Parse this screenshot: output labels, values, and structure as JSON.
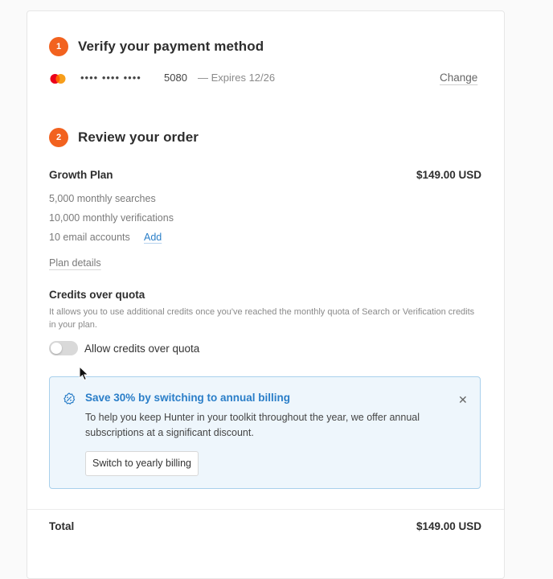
{
  "colors": {
    "accent_orange": "#f2621f",
    "link_blue": "#2a7ec8",
    "banner_bg": "#eef6fc",
    "banner_border": "#a9d0ec"
  },
  "step1": {
    "number": "1",
    "title": "Verify your payment method",
    "card_icon": "mastercard-icon",
    "masked_number": "•••• •••• ••••",
    "last4": "5080",
    "expiry": "— Expires 12/26",
    "change_label": "Change"
  },
  "step2": {
    "number": "2",
    "title": "Review your order",
    "plan": {
      "name": "Growth Plan",
      "price": "$149.00 USD",
      "features": [
        "5,000 monthly searches",
        "10,000 monthly verifications",
        "10 email accounts"
      ],
      "add_label": "Add",
      "details_label": "Plan details"
    },
    "credits": {
      "title": "Credits over quota",
      "description": "It allows you to use additional credits once you've reached the monthly quota of Search or Verification credits in your plan.",
      "toggle_label": "Allow credits over quota",
      "toggle_on": false
    },
    "banner": {
      "icon": "discount-badge-icon",
      "title": "Save 30% by switching to annual billing",
      "text": "To help you keep Hunter in your toolkit throughout the year, we offer annual subscriptions at a significant discount.",
      "button_label": "Switch to yearly billing",
      "close_icon": "close-icon"
    }
  },
  "total": {
    "label": "Total",
    "value": "$149.00 USD"
  }
}
